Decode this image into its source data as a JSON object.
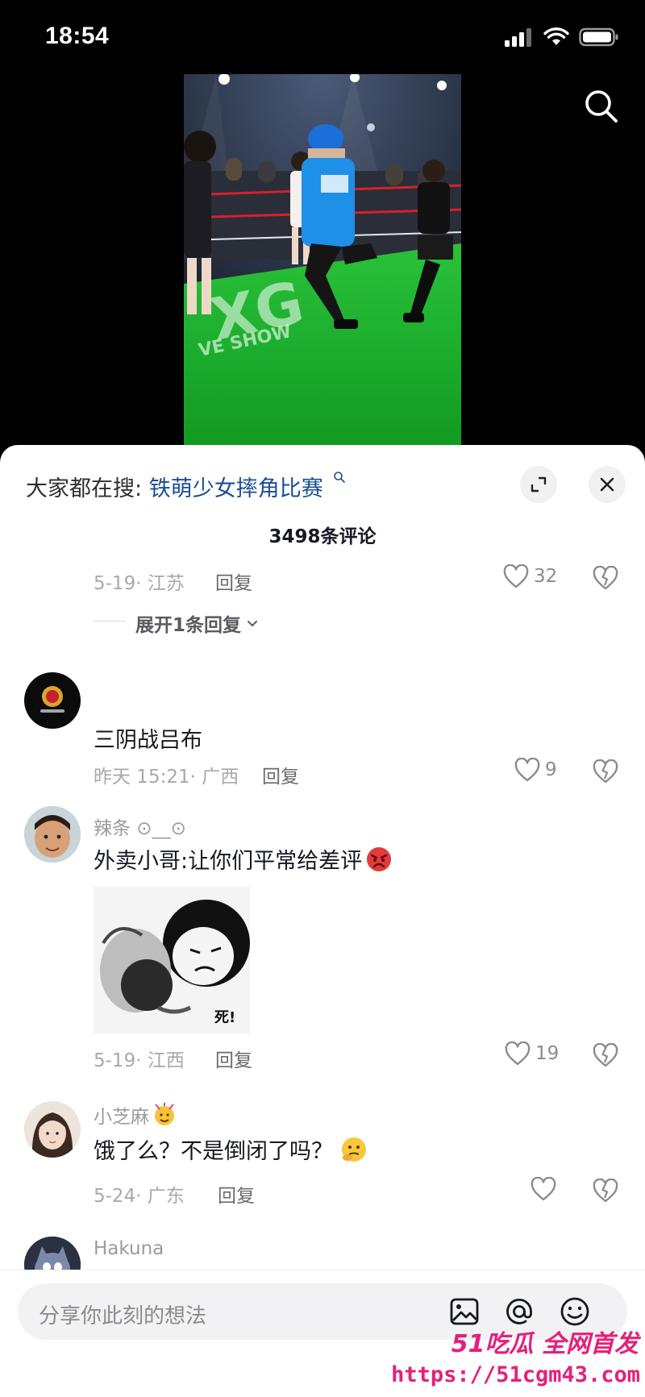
{
  "status_bar": {
    "time": "18:54"
  },
  "sheet": {
    "search_label": "大家都在搜:",
    "search_keyword": "铁萌少女摔角比赛",
    "comment_count": "3498条评论",
    "expand_replies": "展开1条回复"
  },
  "comments": [
    {
      "meta": "5-19· 江苏",
      "reply": "回复",
      "likes": "32"
    },
    {
      "username": "",
      "text": "三阴战吕布",
      "meta": "昨天 15:21· 广西",
      "reply": "回复",
      "likes": "9"
    },
    {
      "username": "辣条 ⊙__⊙",
      "text": "外卖小哥:让你们平常给差评",
      "sticker_caption": "死!",
      "meta": "5-19· 江西",
      "reply": "回复",
      "likes": "19"
    },
    {
      "username": "小芝麻",
      "text": "饿了么？不是倒闭了吗？",
      "meta": "5-24· 广东",
      "reply": "回复",
      "likes": ""
    },
    {
      "username": "Hakuna"
    }
  ],
  "video": {
    "banner_text": "XG",
    "floor_text": "VE SHOW"
  },
  "input": {
    "placeholder": "分享你此刻的想法"
  },
  "watermark": {
    "logo": "51吃瓜 全网首发",
    "url": "https://51cgm43.com"
  },
  "icons": {
    "search": "search-icon",
    "expand": "expand-icon",
    "close": "close-icon",
    "like": "heart-icon",
    "dislike": "broken-heart-icon",
    "image": "image-icon",
    "mention": "at-icon",
    "emoji": "emoji-icon"
  },
  "colors": {
    "keyword": "#1a4f93",
    "watermark": "#e4207a",
    "sheet_bg": "#ffffff"
  }
}
